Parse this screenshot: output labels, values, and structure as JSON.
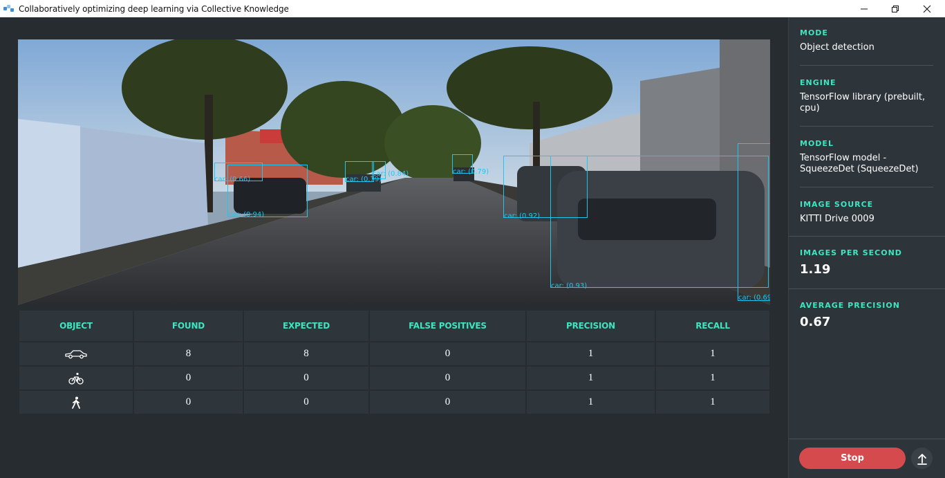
{
  "window": {
    "title": "Collaboratively optimizing deep learning via Collective Knowledge"
  },
  "detections": [
    {
      "label": "car: (0.66)"
    },
    {
      "label": "car: (0.94)"
    },
    {
      "label": "car: (0.79)"
    },
    {
      "label": "car: (0.84)"
    },
    {
      "label": "car: (0.79)"
    },
    {
      "label": "car: (0.92)"
    },
    {
      "label": "car: (0.93)"
    },
    {
      "label": "car: (0.69"
    }
  ],
  "table": {
    "headers": [
      "OBJECT",
      "FOUND",
      "EXPECTED",
      "FALSE POSITIVES",
      "PRECISION",
      "RECALL"
    ],
    "rows": [
      {
        "object_icon": "car-icon",
        "found": "8",
        "expected": "8",
        "false_positives": "0",
        "precision": "1",
        "recall": "1"
      },
      {
        "object_icon": "bicycle-icon",
        "found": "0",
        "expected": "0",
        "false_positives": "0",
        "precision": "1",
        "recall": "1"
      },
      {
        "object_icon": "pedestrian-icon",
        "found": "0",
        "expected": "0",
        "false_positives": "0",
        "precision": "1",
        "recall": "1"
      }
    ]
  },
  "sidebar": {
    "mode": {
      "label": "MODE",
      "value": "Object detection"
    },
    "engine": {
      "label": "ENGINE",
      "value": "TensorFlow library (prebuilt, cpu)"
    },
    "model": {
      "label": "MODEL",
      "value": "TensorFlow model - SqueezeDet (SqueezeDet)"
    },
    "image_source": {
      "label": "IMAGE SOURCE",
      "value": "KITTI Drive 0009"
    },
    "images_per_second": {
      "label": "IMAGES PER SECOND",
      "value": "1.19"
    },
    "average_precision": {
      "label": "AVERAGE PRECISION",
      "value": "0.67"
    }
  },
  "actions": {
    "stop_label": "Stop",
    "upload_icon": "arrow-up-icon"
  },
  "colors": {
    "accent": "#3ee5c0",
    "bbox": "#21c6f0",
    "stop": "#d54a4c",
    "background": "#272c31",
    "panel": "#2e353a"
  }
}
